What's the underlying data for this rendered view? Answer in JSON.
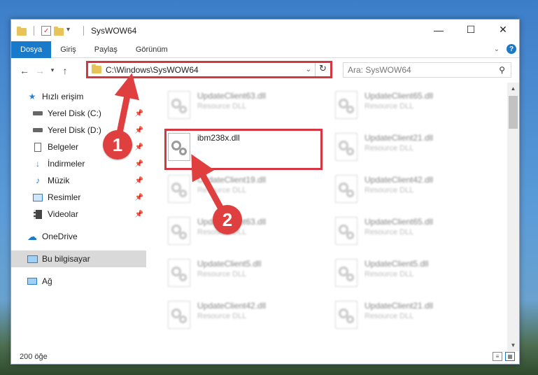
{
  "window": {
    "title": "SysWOW64"
  },
  "controls": {
    "minimize": "—",
    "maximize": "☐",
    "close": "✕"
  },
  "ribbon": {
    "tabs": [
      "Dosya",
      "Giriş",
      "Paylaş",
      "Görünüm"
    ]
  },
  "address": {
    "path": "C:\\Windows\\SysWOW64"
  },
  "search": {
    "placeholder": "Ara: SysWOW64"
  },
  "sidebar": {
    "items": [
      {
        "label": "Hızlı erişim",
        "icon": "star-icon"
      },
      {
        "label": "Yerel Disk (C:)",
        "icon": "drive-icon",
        "pinned": true
      },
      {
        "label": "Yerel Disk (D:)",
        "icon": "drive-icon",
        "pinned": true
      },
      {
        "label": "Belgeler",
        "icon": "documents-icon",
        "pinned": true
      },
      {
        "label": "İndirmeler",
        "icon": "download-icon",
        "pinned": true
      },
      {
        "label": "Müzik",
        "icon": "music-icon",
        "pinned": true
      },
      {
        "label": "Resimler",
        "icon": "pictures-icon",
        "pinned": true
      },
      {
        "label": "Videolar",
        "icon": "video-icon",
        "pinned": true
      },
      {
        "label": "OneDrive",
        "icon": "cloud-icon"
      },
      {
        "label": "Bu bilgisayar",
        "icon": "computer-icon",
        "selected": true
      },
      {
        "label": "Ağ",
        "icon": "network-icon"
      }
    ]
  },
  "files": [
    {
      "name": "UpdateClient63.dll",
      "type": "Resource DLL"
    },
    {
      "name": "UpdateClient65.dll",
      "type": "Resource DLL"
    },
    {
      "name": "ibm238x.dll",
      "type": ""
    },
    {
      "name": "UpdateClient21.dll",
      "type": "Resource DLL"
    },
    {
      "name": "UpdateClient19.dll",
      "type": "Resource DLL"
    },
    {
      "name": "UpdateClient42.dll",
      "type": "Resource DLL"
    },
    {
      "name": "UpdateClient63.dll",
      "type": "Resource DLL"
    },
    {
      "name": "UpdateClient65.dll",
      "type": "Resource DLL"
    },
    {
      "name": "UpdateClient5.dll",
      "type": "Resource DLL"
    },
    {
      "name": "UpdateClient5.dll",
      "type": "Resource DLL"
    },
    {
      "name": "UpdateClient42.dll",
      "type": "Resource DLL"
    },
    {
      "name": "UpdateClient21.dll",
      "type": "Resource DLL"
    }
  ],
  "status": {
    "count": "200 öğe"
  },
  "annotations": {
    "step1": "1",
    "step2": "2"
  },
  "colors": {
    "accent": "#1979ca",
    "highlight": "#d6363f"
  }
}
